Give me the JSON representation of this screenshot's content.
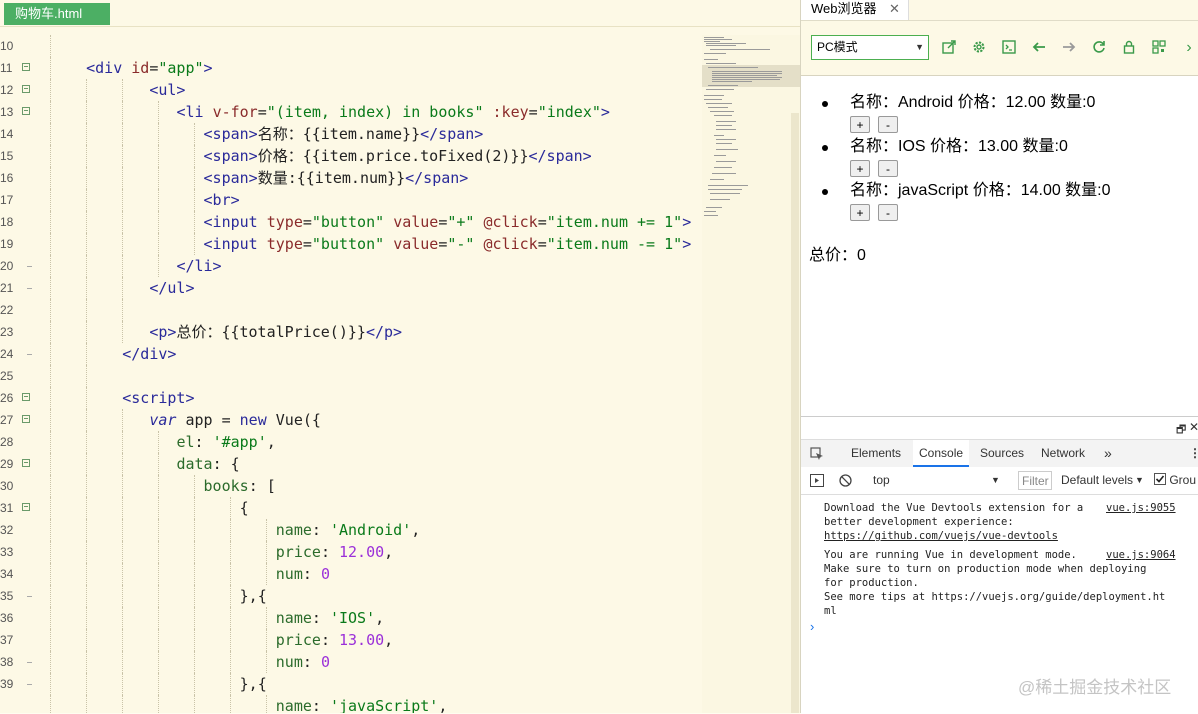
{
  "editor": {
    "file_tab": "购物车.html",
    "line_numbers": [
      "10",
      "11",
      "12",
      "13",
      "14",
      "15",
      "16",
      "17",
      "18",
      "19",
      "20",
      "21",
      "22",
      "23",
      "24",
      "25",
      "26",
      "27",
      "28",
      "29",
      "30",
      "31",
      "32",
      "33",
      "34",
      "35",
      "36",
      "37",
      "38",
      "39"
    ],
    "fold_lines": [
      "11",
      "12",
      "13",
      "26",
      "27",
      "29",
      "31"
    ]
  },
  "browser": {
    "tab_title": "Web浏览器",
    "tab_close": "✕",
    "mode_select": "PC模式",
    "toolbar_icons": [
      "open-external-icon",
      "settings-icon",
      "console-icon",
      "back-icon",
      "forward-icon",
      "refresh-icon",
      "lock-icon",
      "qrcode-icon"
    ],
    "toolbar_more": "›",
    "items": [
      {
        "text": "名称：Android 价格：12.00 数量:0",
        "plus": "+",
        "minus": "-"
      },
      {
        "text": "名称：IOS 价格：13.00 数量:0",
        "plus": "+",
        "minus": "-"
      },
      {
        "text": "名称：javaScript 价格：14.00 数量:0",
        "plus": "+",
        "minus": "-"
      }
    ],
    "total": "总价：0"
  },
  "devtools": {
    "tabs": [
      "Elements",
      "Console",
      "Sources",
      "Network"
    ],
    "more_tabs": "»",
    "context": "top",
    "filter_placeholder": "Filter",
    "levels": "Default levels",
    "group_label": "Grou",
    "messages": [
      {
        "lines": [
          "Download the Vue Devtools extension for a",
          "better development experience:",
          "https://github.com/vuejs/vue-devtools"
        ],
        "source": "vue.js:9055"
      },
      {
        "lines": [
          "You are running Vue in development mode.",
          "Make sure to turn on production mode when deploying",
          "for production.",
          "See more tips at https://vuejs.org/guide/deployment.ht",
          "ml"
        ],
        "source": "vue.js:9064"
      }
    ],
    "prompt": "›"
  },
  "watermark": "@稀土掘金技术社区"
}
